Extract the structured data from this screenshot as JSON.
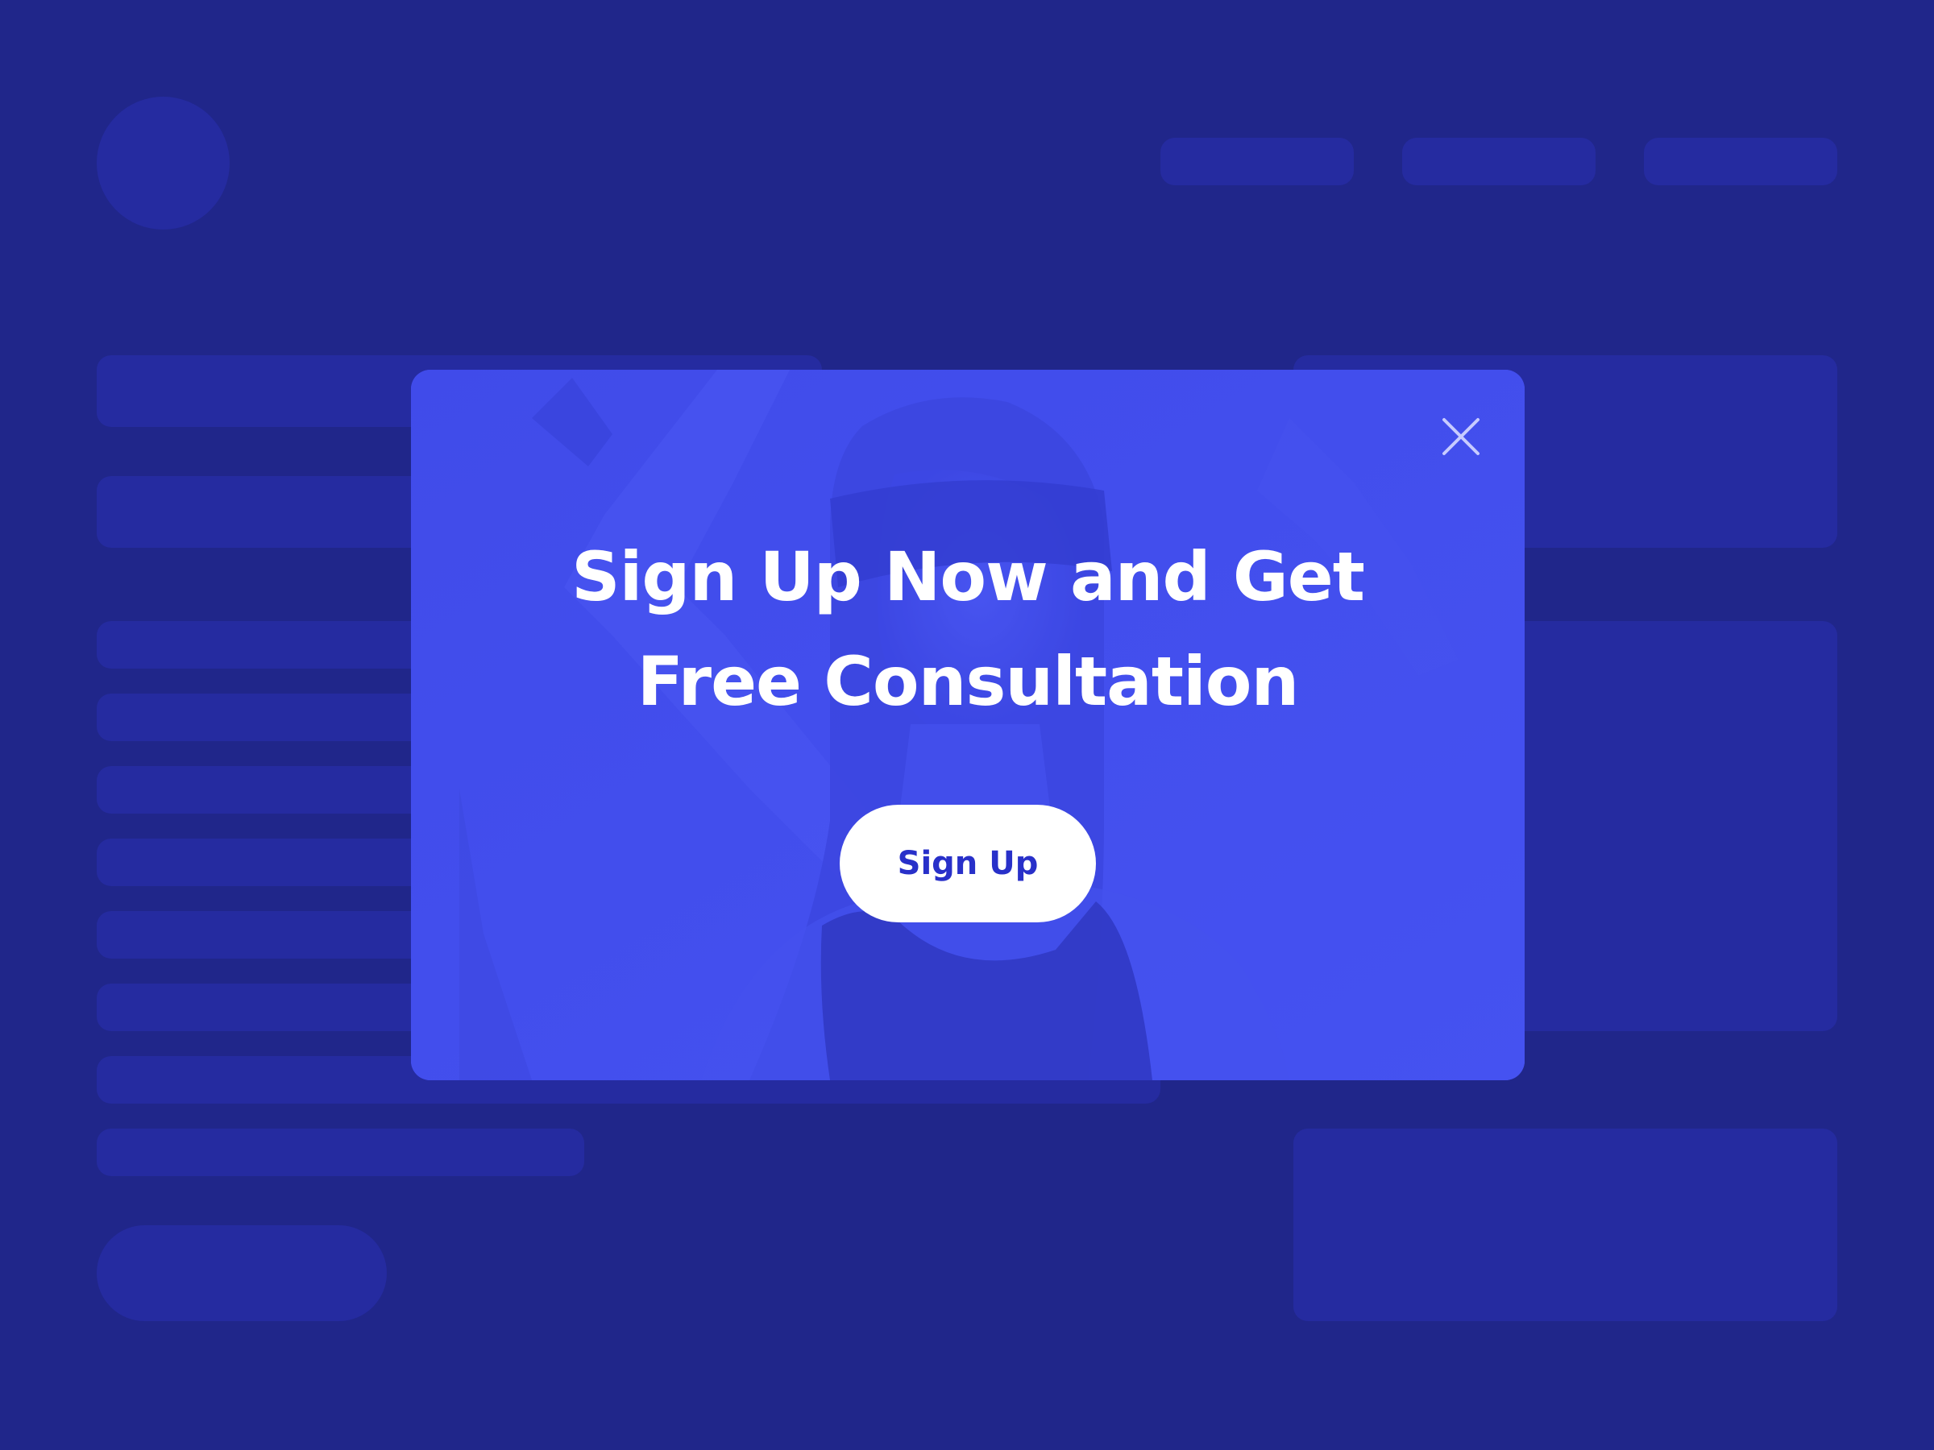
{
  "background_page": {
    "description_role": "blurred placeholder page behind modal"
  },
  "modal": {
    "title_line_1": "Sign Up Now and Get",
    "title_line_2": "Free Consultation",
    "signup_button_label": "Sign Up",
    "close_icon": "close-icon"
  },
  "colors": {
    "page_background": "#20268a",
    "placeholder_blocks": "#252ba0",
    "modal_overlay": "#424ff0",
    "button_background": "#ffffff",
    "button_text": "#2830c9"
  }
}
